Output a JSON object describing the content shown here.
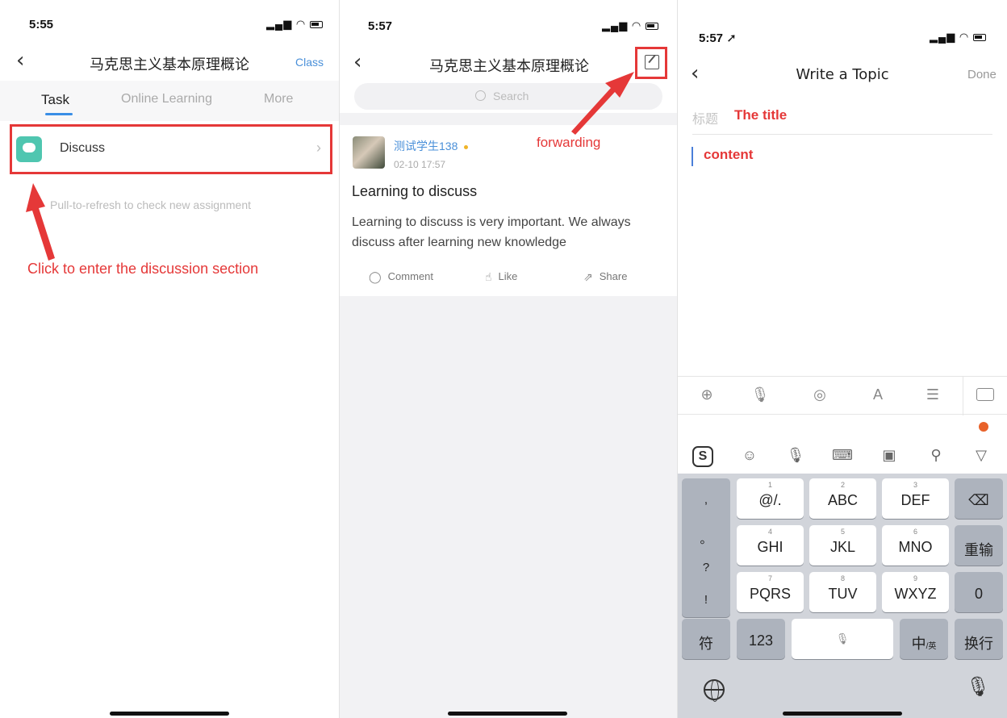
{
  "screen1": {
    "status": {
      "time": "5:55"
    },
    "nav": {
      "title": "马克思主义基本原理概论",
      "right": "Class"
    },
    "tabs": [
      "Task",
      "Online Learning",
      "More"
    ],
    "item": {
      "label": "Discuss"
    },
    "hint": "Pull-to-refresh to check new assignment",
    "annotation": "Click to enter the discussion section"
  },
  "screen2": {
    "status": {
      "time": "5:57"
    },
    "nav": {
      "title": "马克思主义基本原理概论"
    },
    "search": {
      "placeholder": "Search"
    },
    "annotation": "forwarding",
    "post": {
      "author": "测试学生138",
      "time": "02-10 17:57",
      "title": "Learning to discuss",
      "body": "Learning to discuss is very important. We always discuss after learning new knowledge",
      "actions": [
        "Comment",
        "Like",
        "Share"
      ]
    }
  },
  "screen3": {
    "status": {
      "time": "5:57"
    },
    "nav": {
      "title": "Write a Topic",
      "right": "Done"
    },
    "title_label": "标题",
    "title_value": "The title",
    "content_value": "content",
    "ime": {
      "left_symbols": [
        ",",
        "。",
        "?",
        "!"
      ],
      "keys": [
        {
          "num": "1",
          "label": "@/."
        },
        {
          "num": "2",
          "label": "ABC"
        },
        {
          "num": "3",
          "label": "DEF"
        },
        {
          "num": "4",
          "label": "GHI"
        },
        {
          "num": "5",
          "label": "JKL"
        },
        {
          "num": "6",
          "label": "MNO"
        },
        {
          "num": "7",
          "label": "PQRS"
        },
        {
          "num": "8",
          "label": "TUV"
        },
        {
          "num": "9",
          "label": "WXYZ"
        }
      ],
      "reenter": "重输",
      "zero": "0",
      "fu": "符",
      "num123": "123",
      "zhong": "中",
      "zhong_sub": "/英",
      "enter": "换行"
    }
  }
}
